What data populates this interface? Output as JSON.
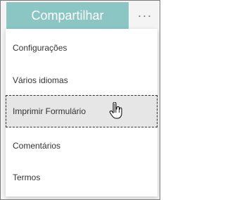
{
  "toolbar": {
    "share_label": "Compartilhar",
    "more_glyph": "···",
    "more_icon": "more-horizontal-icon",
    "share_color": "#8cc6c4"
  },
  "menu": {
    "items": [
      {
        "label": "Configurações"
      },
      {
        "label": "Vários idiomas"
      },
      {
        "label": "Imprimir Formulário",
        "state": "hovered"
      },
      {
        "label": "Comentários"
      },
      {
        "label": "Termos"
      }
    ]
  },
  "pointer": {
    "icon": "hand-pointer-icon"
  }
}
